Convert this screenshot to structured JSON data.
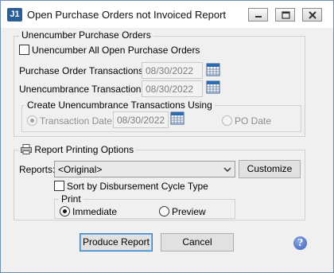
{
  "window": {
    "app_icon": "J1",
    "title": "Open Purchase Orders not Invoiced Report"
  },
  "unencumber": {
    "group_title": "Unencumber Purchase Orders",
    "checkbox_label": "Unencumber All Open Purchase Orders",
    "checked": false,
    "po_txn_label": "Purchase Order Transactions:",
    "po_txn_date": "08/30/2022",
    "unenc_txn_label": "Unencumbrance Transactions:",
    "unenc_txn_date": "08/30/2022",
    "create_group_title": "Create Unencumbrance Transactions Using",
    "txn_date_label": "Transaction Date:",
    "txn_date_value": "08/30/2022",
    "po_date_label": "PO Date",
    "selected": "Transaction Date"
  },
  "report": {
    "group_title": "Report Printing Options",
    "reports_label": "Reports:",
    "reports_value": "<Original>",
    "customize_label": "Customize",
    "sort_label": "Sort by Disbursement Cycle Type",
    "sort_checked": false,
    "print_title": "Print",
    "immediate_label": "Immediate",
    "preview_label": "Preview",
    "print_selected": "Immediate"
  },
  "buttons": {
    "produce": "Produce Report",
    "cancel": "Cancel"
  },
  "icons": {
    "app": "j1-app-icon",
    "minimize": "minimize-icon",
    "maximize": "maximize-icon",
    "close": "close-icon",
    "calendar": "calendar-icon",
    "printer": "printer-icon",
    "dropdown": "chevron-down-icon",
    "help": "help-icon"
  }
}
